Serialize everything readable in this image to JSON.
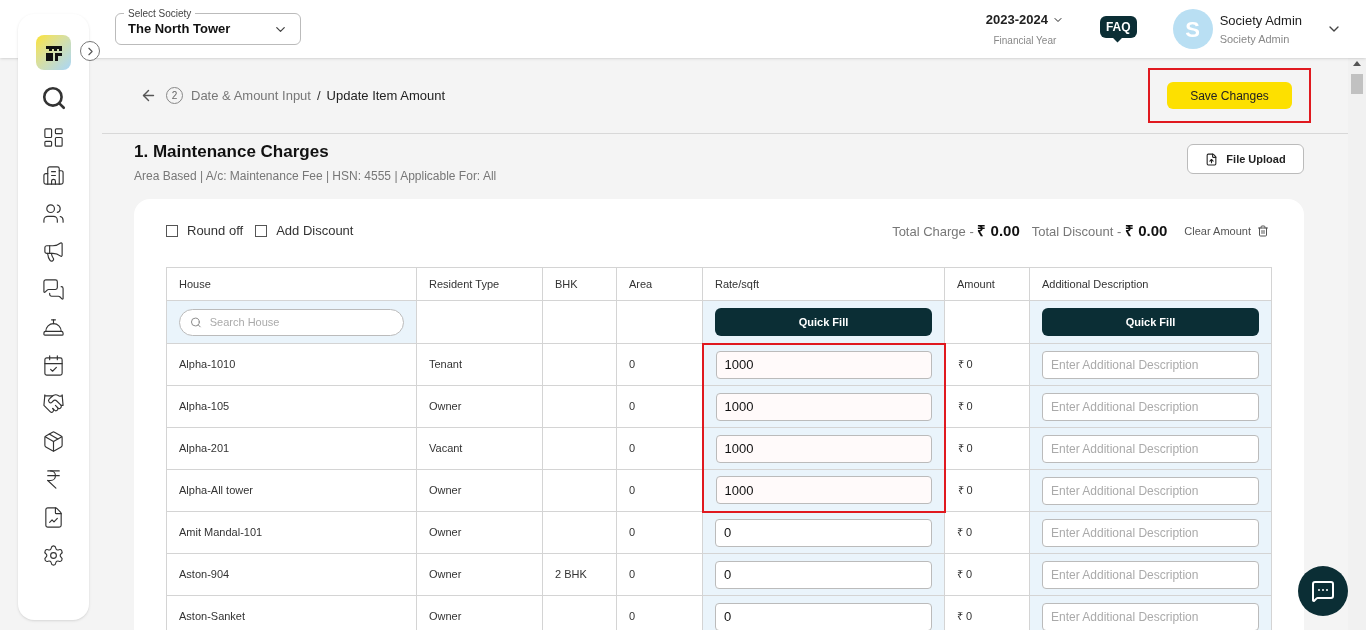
{
  "header": {
    "society_label": "Select Society",
    "society": "The North Tower",
    "year": "2023-2024",
    "year_label": "Financial Year",
    "faq": "FAQ",
    "avatar_letter": "S",
    "user_name": "Society Admin",
    "user_role": "Society Admin"
  },
  "breadcrumb": {
    "step": "2",
    "parent": "Date & Amount Input",
    "separator": "/",
    "current": "Update Item Amount"
  },
  "save_button": {
    "label": "Save Changes",
    "highlighted": true
  },
  "section": {
    "title": "1. Maintenance Charges",
    "subtitle": "Area Based | A/c: Maintenance Fee | HSN: 4555 | Applicable For: All",
    "upload_button": "File Upload"
  },
  "options": [
    {
      "label": "Round off",
      "checked": false
    },
    {
      "label": "Add Discount",
      "checked": false
    }
  ],
  "totals": {
    "charge_label": "Total Charge - ",
    "charge": "₹ 0.00",
    "discount_label": "Total Discount - ",
    "discount": "₹ 0.00",
    "clear": "Clear Amount"
  },
  "table": {
    "columns": [
      "House",
      "Resident Type",
      "BHK",
      "Area",
      "Rate/sqft",
      "Amount",
      "Additional Description"
    ],
    "search_placeholder": "Search House",
    "quick_fill": [
      "Quick Fill",
      "Quick Fill"
    ],
    "rows": [
      {
        "house": "Alpha-1010",
        "resident_type": "Tenant",
        "bhk": "",
        "area": "0",
        "rate": "1000",
        "amount": "₹ 0",
        "description_placeholder": "Enter Additional Description",
        "highlighted": true
      },
      {
        "house": "Alpha-105",
        "resident_type": "Owner",
        "bhk": "",
        "area": "0",
        "rate": "1000",
        "amount": "₹ 0",
        "description_placeholder": "Enter Additional Description",
        "highlighted": true
      },
      {
        "house": "Alpha-201",
        "resident_type": "Vacant",
        "bhk": "",
        "area": "0",
        "rate": "1000",
        "amount": "₹ 0",
        "description_placeholder": "Enter Additional Description",
        "highlighted": true
      },
      {
        "house": "Alpha-All tower",
        "resident_type": "Owner",
        "bhk": "",
        "area": "0",
        "rate": "1000",
        "amount": "₹ 0",
        "description_placeholder": "Enter Additional Description",
        "highlighted": true
      },
      {
        "house": "Amit Mandal-101",
        "resident_type": "Owner",
        "bhk": "",
        "area": "0",
        "rate": "0",
        "amount": "₹ 0",
        "description_placeholder": "Enter Additional Description",
        "highlighted": false
      },
      {
        "house": "Aston-904",
        "resident_type": "Owner",
        "bhk": "2 BHK",
        "area": "0",
        "rate": "0",
        "amount": "₹ 0",
        "description_placeholder": "Enter Additional Description",
        "highlighted": false
      },
      {
        "house": "Aston-Sanket",
        "resident_type": "Owner",
        "bhk": "",
        "area": "0",
        "rate": "0",
        "amount": "₹ 0",
        "description_placeholder": "Enter Additional Description",
        "highlighted": false
      }
    ]
  }
}
